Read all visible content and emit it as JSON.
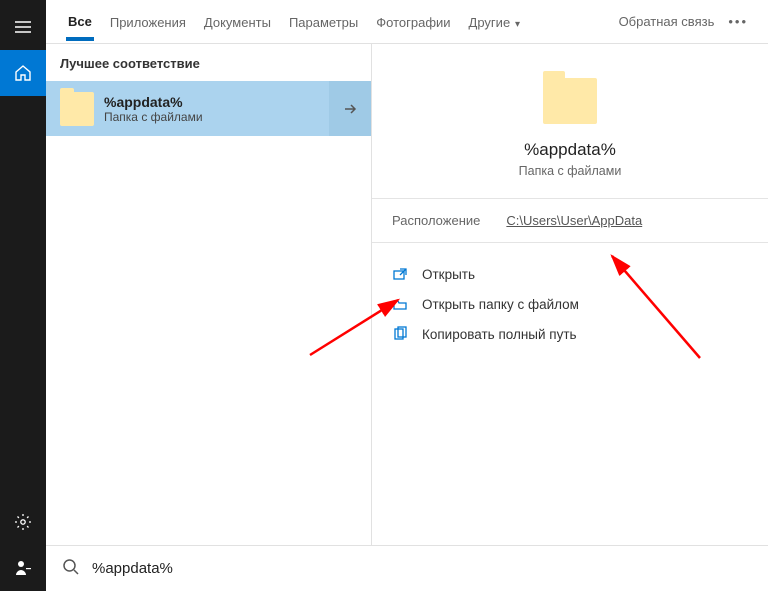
{
  "tabs": {
    "all": "Все",
    "apps": "Приложения",
    "docs": "Документы",
    "params": "Параметры",
    "photos": "Фотографии",
    "other": "Другие",
    "feedback": "Обратная связь"
  },
  "section": {
    "best_match": "Лучшее соответствие"
  },
  "result": {
    "title": "%appdata%",
    "subtitle": "Папка с файлами"
  },
  "preview": {
    "title": "%appdata%",
    "subtitle": "Папка с файлами",
    "location_label": "Расположение",
    "location_path": "C:\\Users\\User\\AppData"
  },
  "actions": {
    "open": "Открыть",
    "open_folder": "Открыть папку с файлом",
    "copy_path": "Копировать полный путь"
  },
  "search": {
    "value": "%appdata%"
  }
}
